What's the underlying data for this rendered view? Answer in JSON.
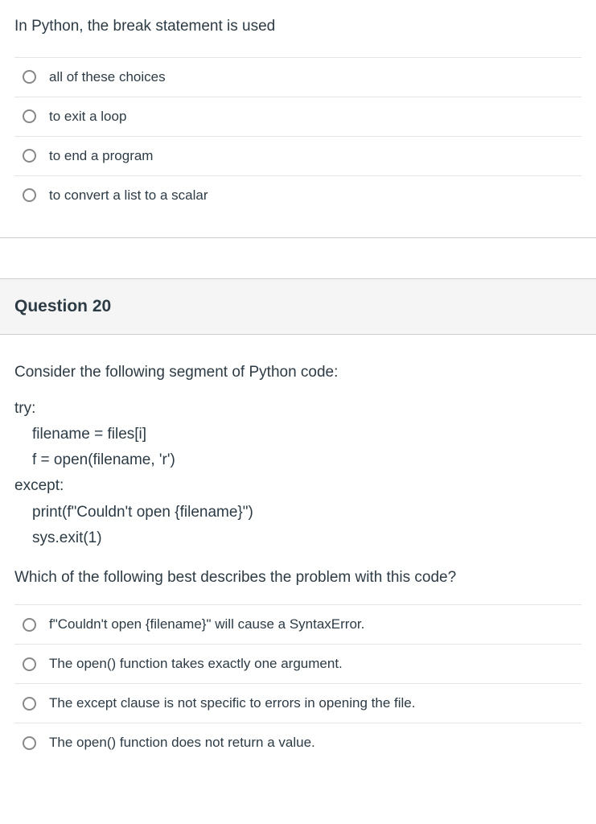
{
  "q1": {
    "prompt": "In Python, the break statement is used",
    "options": [
      "all of these choices",
      "to exit a loop",
      "to end a program",
      "to convert a list to a scalar"
    ]
  },
  "q2": {
    "header": "Question 20",
    "prompt": "Consider the following segment of Python code:",
    "code": {
      "l1": "try:",
      "l2": "filename = files[i]",
      "l3": "f = open(filename, 'r')",
      "l4": "except:",
      "l5": "print(f\"Couldn't open {filename}\")",
      "l6": "sys.exit(1)"
    },
    "followup": "Which of the following best describes the problem with this code?",
    "options": [
      "f\"Couldn't open {filename}\" will cause a SyntaxError.",
      "The open() function takes exactly one argument.",
      "The except clause is not specific to errors in opening the file.",
      "The open() function does not return a value."
    ]
  }
}
